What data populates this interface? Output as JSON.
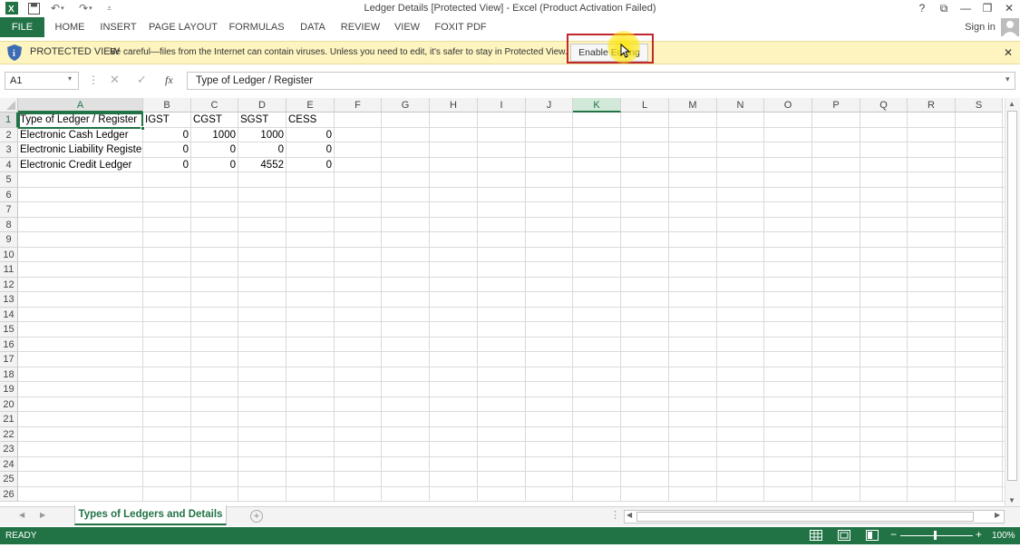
{
  "window": {
    "title": "Ledger Details  [Protected View] - Excel (Product Activation Failed)",
    "help": "?",
    "ribbon_display": "⧉",
    "minimize": "—",
    "restore": "❐",
    "close": "✕",
    "sign_in": "Sign in"
  },
  "ribbon": {
    "file": "FILE",
    "tabs": [
      "HOME",
      "INSERT",
      "PAGE LAYOUT",
      "FORMULAS",
      "DATA",
      "REVIEW",
      "VIEW",
      "FOXIT PDF"
    ]
  },
  "protected_view": {
    "label": "PROTECTED VIEW",
    "message": "Be careful—files from the Internet can contain viruses. Unless you need to edit, it's safer to stay in Protected View.",
    "button": "Enable Editing",
    "close": "✕"
  },
  "formula_bar": {
    "name_box": "A1",
    "fx": "fx",
    "content": "Type of Ledger / Register"
  },
  "grid": {
    "selected_cell": "A1",
    "highlighted_column": "K",
    "columns": [
      "A",
      "B",
      "C",
      "D",
      "E",
      "F",
      "G",
      "H",
      "I",
      "J",
      "K",
      "L",
      "M",
      "N",
      "O",
      "P",
      "Q",
      "R",
      "S"
    ],
    "rows": [
      "1",
      "2",
      "3",
      "4",
      "5",
      "6",
      "7",
      "8",
      "9",
      "10",
      "11",
      "12",
      "13",
      "14",
      "15",
      "16",
      "17",
      "18",
      "19",
      "20",
      "21",
      "22",
      "23",
      "24",
      "25",
      "26"
    ],
    "cells": [
      [
        "Type of Ledger / Register",
        "IGST",
        "CGST",
        "SGST",
        "CESS"
      ],
      [
        "Electronic Cash Ledger",
        "0",
        "1000",
        "1000",
        "0"
      ],
      [
        "Electronic Liability Register",
        "0",
        "0",
        "0",
        "0"
      ],
      [
        "Electronic Credit Ledger",
        "0",
        "0",
        "4552",
        "0"
      ]
    ]
  },
  "sheets": {
    "active": "Types of Ledgers and Details",
    "add": "+"
  },
  "status": {
    "ready": "READY",
    "zoom": "100%",
    "zoom_minus": "−",
    "zoom_plus": "+"
  },
  "colors": {
    "excel_green": "#217346",
    "protected_bg": "#fdf4bf",
    "highlight_border": "#c0282d",
    "cursor_highlight": "#ffe600"
  }
}
